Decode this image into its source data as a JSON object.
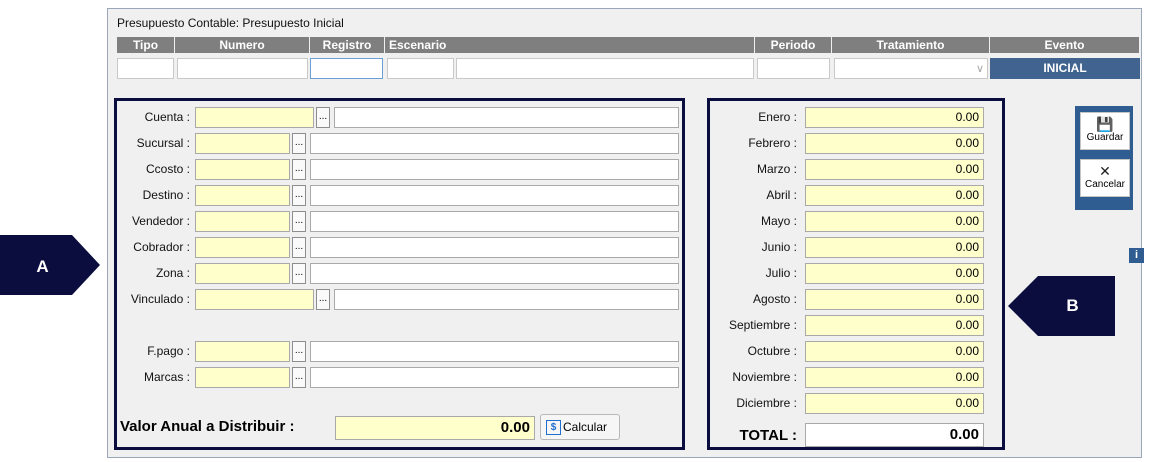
{
  "window_title": "Presupuesto Contable: Presupuesto Inicial",
  "header": {
    "columns": [
      "Tipo",
      "Numero",
      "Registro",
      "Escenario",
      "Periodo",
      "Tratamiento",
      "Evento"
    ],
    "evento_value": "INICIAL"
  },
  "panel_a": {
    "fields": [
      {
        "label": "Cuenta :"
      },
      {
        "label": "Sucursal :"
      },
      {
        "label": "Ccosto :"
      },
      {
        "label": "Destino :"
      },
      {
        "label": "Vendedor :"
      },
      {
        "label": "Cobrador :"
      },
      {
        "label": "Zona :"
      },
      {
        "label": "Vinculado :"
      },
      {
        "label": "F.pago :"
      },
      {
        "label": "Marcas :"
      }
    ],
    "lookup_button": "...",
    "valor_label": "Valor Anual  a  Distribuir :",
    "valor_value": "0.00",
    "calcular_label": "Calcular",
    "calcular_icon": "$"
  },
  "panel_b": {
    "months": [
      {
        "label": "Enero :",
        "value": "0.00"
      },
      {
        "label": "Febrero :",
        "value": "0.00"
      },
      {
        "label": "Marzo :",
        "value": "0.00"
      },
      {
        "label": "Abril :",
        "value": "0.00"
      },
      {
        "label": "Mayo :",
        "value": "0.00"
      },
      {
        "label": "Junio :",
        "value": "0.00"
      },
      {
        "label": "Julio :",
        "value": "0.00"
      },
      {
        "label": "Agosto :",
        "value": "0.00"
      },
      {
        "label": "Septiembre :",
        "value": "0.00"
      },
      {
        "label": "Octubre :",
        "value": "0.00"
      },
      {
        "label": "Noviembre :",
        "value": "0.00"
      },
      {
        "label": "Diciembre :",
        "value": "0.00"
      }
    ],
    "total_label": "TOTAL :",
    "total_value": "0.00"
  },
  "toolbar": {
    "guardar_label": "Guardar",
    "cancelar_label": "Cancelar",
    "info_label": "i"
  },
  "callouts": {
    "a": "A",
    "b": "B"
  },
  "colors": {
    "header_bg": "#7f7f7f",
    "evento_bg": "#41638f",
    "panel_border": "#0b0d3f",
    "field_yellow": "#ffffcc",
    "callout_bg": "#0b0d3f",
    "toolbar_bg": "#2f5c91"
  }
}
